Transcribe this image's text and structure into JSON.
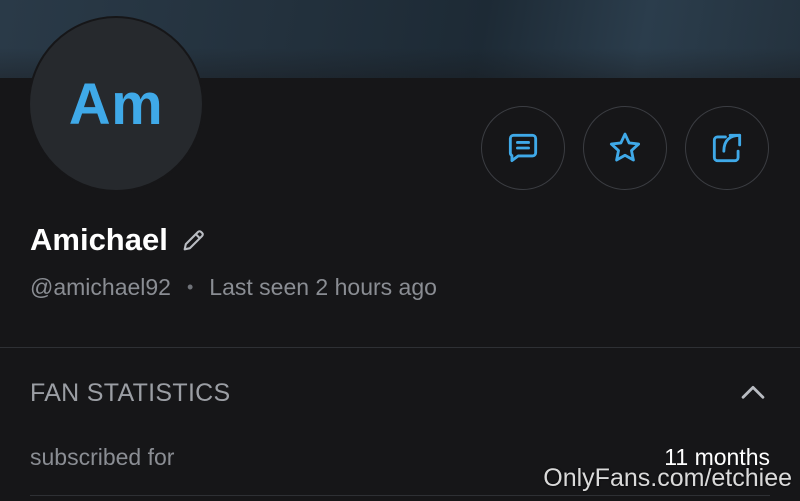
{
  "profile": {
    "avatar_initials": "Am",
    "display_name": "Amichael",
    "username": "@amichael92",
    "separator": "•",
    "last_seen": "Last seen 2 hours ago"
  },
  "actions": {
    "message_icon": "message-icon",
    "favorite_icon": "star-icon",
    "share_icon": "share-icon"
  },
  "fan_statistics": {
    "title": "FAN STATISTICS",
    "rows": [
      {
        "label": "subscribed for",
        "value": "11 months"
      }
    ]
  },
  "watermark": "OnlyFans.com/etchiee",
  "colors": {
    "accent": "#3fa9e8",
    "background": "#161618",
    "text_primary": "#ffffff",
    "text_secondary": "#8a8d93"
  }
}
